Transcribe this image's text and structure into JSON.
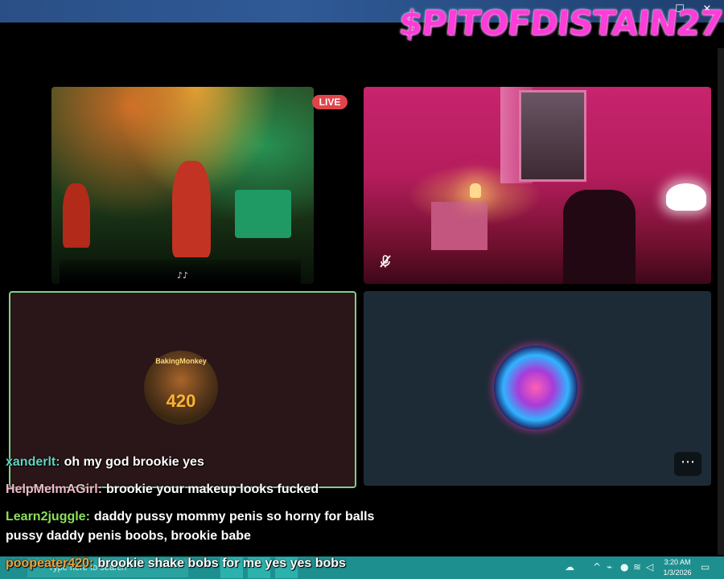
{
  "window": {
    "maximize_glyph": "☐",
    "close_glyph": "✕"
  },
  "brand": {
    "text": "$PITOFDISTAIN27",
    "color": "#ff3bd9"
  },
  "stage": {
    "live_badge": "LIVE",
    "live_color": "#e0444a",
    "music_glyph": "♪♪",
    "avatar_monkey_name": "BakingMonkey",
    "avatar_monkey_number": "420",
    "active_speaker_border": "#7fd18b",
    "more_button_glyph": "⋯"
  },
  "chat": [
    {
      "user": "xanderlt:",
      "user_color": "#5fd6c0",
      "message": "oh my god brookie yes"
    },
    {
      "user": "HelpMeImAGirl:",
      "user_color": "#f0b9c8",
      "message": "brookie your makeup looks fucked"
    },
    {
      "user": "Learn2juggle:",
      "user_color": "#8be05a",
      "message": "daddy pussy mommy penis so horny for balls"
    },
    {
      "user": "",
      "user_color": "#ffffff",
      "message": "pussy daddy penis boobs, brookie babe"
    },
    {
      "user": "poopeater420:",
      "user_color": "#f2a23a",
      "message": "brookie shake bobs for me yes yes bobs"
    }
  ],
  "taskbar": {
    "search_placeholder": "Type here to search",
    "time": "3:20 AM",
    "date": "1/3/2026",
    "tray_icons": [
      "weather-icon",
      "chevron-up-icon",
      "network-icon",
      "microphone-icon",
      "wifi-icon",
      "volume-icon",
      "notifications-icon"
    ]
  }
}
